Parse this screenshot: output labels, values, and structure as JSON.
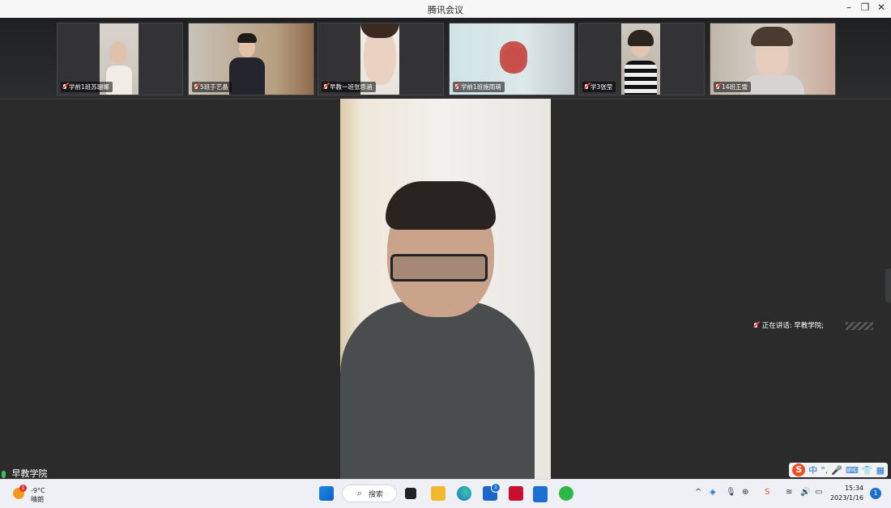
{
  "window": {
    "title": "腾讯会议"
  },
  "participants": [
    {
      "label": "学前1班苏珊娜"
    },
    {
      "label": "5班于艺晶"
    },
    {
      "label": "早教一班张思涵"
    },
    {
      "label": "学前1班施雨萌"
    },
    {
      "label": "学3张莹"
    },
    {
      "label": "14班王雪"
    }
  ],
  "speaking": {
    "text": "正在讲话: 早教学院;"
  },
  "local_user": {
    "name": "早教学院"
  },
  "ime": {
    "mode": "中",
    "punct": "°,"
  },
  "taskbar": {
    "weather": {
      "temp": "-9°C",
      "desc": "晴朗",
      "badge": "1"
    },
    "search_label": "搜索",
    "store_badge": "1",
    "time": "15:34",
    "date": "2023/1/16",
    "notification_count": "1"
  }
}
